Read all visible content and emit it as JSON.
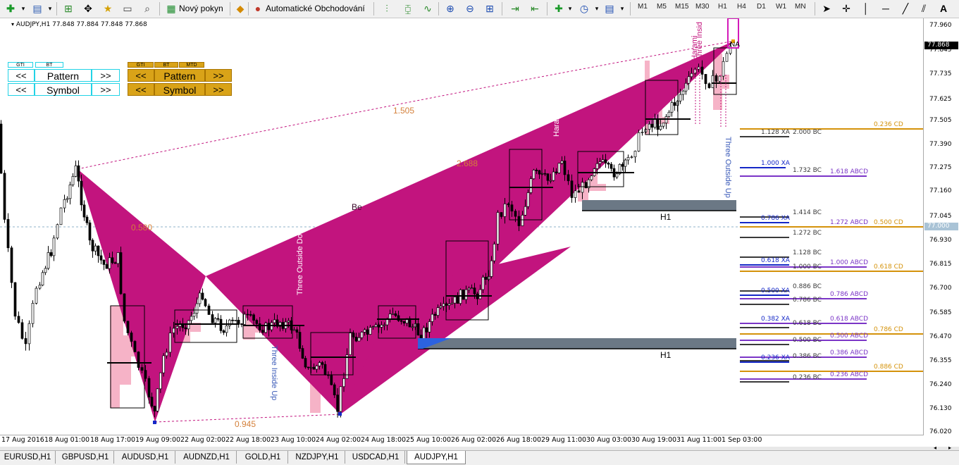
{
  "toolbar": {
    "new_order": "Nový pokyn",
    "auto_trading": "Automatické Obchodování",
    "timeframes": [
      "M1",
      "M5",
      "M15",
      "M30",
      "H1",
      "H4",
      "D1",
      "W1",
      "MN"
    ]
  },
  "chart": {
    "symbol_info": "AUDJPY,H1  77.848 77.884 77.848 77.868",
    "panel_cyan": {
      "tags": [
        "GTI",
        "BT"
      ],
      "row1": {
        "prev": "<<",
        "label": "Pattern",
        "next": ">>"
      },
      "row2": {
        "prev": "<<",
        "label": "Symbol",
        "next": ">>"
      }
    },
    "panel_gold": {
      "tags": [
        "GTI",
        "BT",
        "MTD"
      ],
      "row1": {
        "prev": "<<",
        "label": "Pattern",
        "next": ">>"
      },
      "row2": {
        "prev": "<<",
        "label": "Symbol",
        "next": ">>"
      }
    },
    "annotations": {
      "ratio_1505": "1.505",
      "ratio_2688": "2.688",
      "ratio_0580": "0.580",
      "ratio_0945": "0.945",
      "bearish_partial": "Be",
      "three_outside_down": "Three Outside Down",
      "three_inside_up": "Three Inside Up",
      "harami_1": "Harami",
      "harami_2": "Harami",
      "three_inside_top": "Three Insid",
      "three_outside_up": "Three Outside Up",
      "zone_upper": "H1",
      "zone_lower": "H1",
      "na_label": "NA"
    },
    "fib_levels": [
      {
        "text": "0.236 CD",
        "color": "#d4920a"
      },
      {
        "text": "1.128 XA",
        "color": "#3a3a3a"
      },
      {
        "text": "2.000 BC",
        "color": "#3a3a3a"
      },
      {
        "text": "1.000 XA",
        "color": "#1528c7"
      },
      {
        "text": "1.732 BC",
        "color": "#3a3a3a"
      },
      {
        "text": "1.618 ABCD",
        "color": "#7b35c7"
      },
      {
        "text": "1.414 BC",
        "color": "#3a3a3a"
      },
      {
        "text": "0.786 XA",
        "color": "#1528c7"
      },
      {
        "text": "1.272 ABCD",
        "color": "#7b35c7"
      },
      {
        "text": "0.500 CD",
        "color": "#d4920a"
      },
      {
        "text": "1.272 BC",
        "color": "#3a3a3a"
      },
      {
        "text": "1.128 BC",
        "color": "#3a3a3a"
      },
      {
        "text": "0.618 XA",
        "color": "#1528c7"
      },
      {
        "text": "1.000 ABCD",
        "color": "#7b35c7"
      },
      {
        "text": "1.000 BC",
        "color": "#3a3a3a"
      },
      {
        "text": "0.618 CD",
        "color": "#d4920a"
      },
      {
        "text": "0.886 BC",
        "color": "#3a3a3a"
      },
      {
        "text": "0.500 XA",
        "color": "#1528c7"
      },
      {
        "text": "0.786 ABCD",
        "color": "#7b35c7"
      },
      {
        "text": "0.786 BC",
        "color": "#3a3a3a"
      },
      {
        "text": "0.382 XA",
        "color": "#1528c7"
      },
      {
        "text": "0.618 ABCD",
        "color": "#7b35c7"
      },
      {
        "text": "0.618 BC",
        "color": "#3a3a3a"
      },
      {
        "text": "0.786 CD",
        "color": "#d4920a"
      },
      {
        "text": "0.500 ABCD",
        "color": "#7b35c7"
      },
      {
        "text": "0.500 BC",
        "color": "#3a3a3a"
      },
      {
        "text": "0.386 ABCD",
        "color": "#7b35c7"
      },
      {
        "text": "0.386 BC",
        "color": "#3a3a3a"
      },
      {
        "text": "0.236 XA",
        "color": "#1528c7"
      },
      {
        "text": "0.886 CD",
        "color": "#d4920a"
      },
      {
        "text": "0.236 ABCD",
        "color": "#7b35c7"
      },
      {
        "text": "0.236 BC",
        "color": "#3a3a3a"
      }
    ],
    "colors": {
      "pattern_fill": "#c2147e",
      "volume_profile": "#f6b3c7",
      "zone_bar": "#6b7885",
      "zone_blue": "#2c62e0",
      "crosshair": "#8fb3c9"
    }
  },
  "price_scale": {
    "labels": [
      "77.960",
      "77.868",
      "77.845",
      "77.735",
      "77.625",
      "77.505",
      "77.390",
      "77.275",
      "77.160",
      "77.045",
      "77.000",
      "76.930",
      "76.815",
      "76.700",
      "76.585",
      "76.470",
      "76.355",
      "76.240",
      "76.130",
      "76.020"
    ],
    "current": "77.868",
    "crosshair": "77.000"
  },
  "time_axis": {
    "labels": [
      "17 Aug 2016",
      "18 Aug 01:00",
      "18 Aug 17:00",
      "19 Aug 09:00",
      "22 Aug 02:00",
      "22 Aug 18:00",
      "23 Aug 10:00",
      "24 Aug 02:00",
      "24 Aug 18:00",
      "25 Aug 10:00",
      "26 Aug 02:00",
      "26 Aug 18:00",
      "29 Aug 11:00",
      "30 Aug 03:00",
      "30 Aug 19:00",
      "31 Aug 11:00",
      "1 Sep 03:00"
    ]
  },
  "tabs": [
    "EURUSD,H1",
    "GBPUSD,H1",
    "AUDUSD,H1",
    "AUDNZD,H1",
    "GOLD,H1",
    "NZDJPY,H1",
    "USDCAD,H1",
    "AUDJPY,H1"
  ],
  "active_tab": "AUDJPY,H1"
}
